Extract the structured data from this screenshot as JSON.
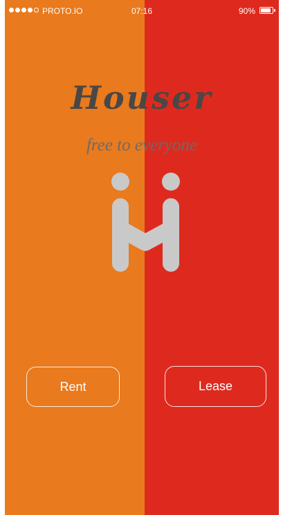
{
  "status_bar": {
    "signal_filled": 4,
    "signal_total": 5,
    "carrier": "PROTO.IO",
    "time": "07:16",
    "battery_percent": "90%",
    "battery_level": 0.9
  },
  "branding": {
    "title": "Houser",
    "tagline": "free to everyone",
    "logo_icon": "houser-logo-icon"
  },
  "actions": {
    "rent_label": "Rent",
    "lease_label": "Lease"
  },
  "colors": {
    "left_panel": "#E97A1E",
    "right_panel": "#DE2A1E",
    "logo": "#C9C9C9",
    "title_text": "#4A4745"
  }
}
